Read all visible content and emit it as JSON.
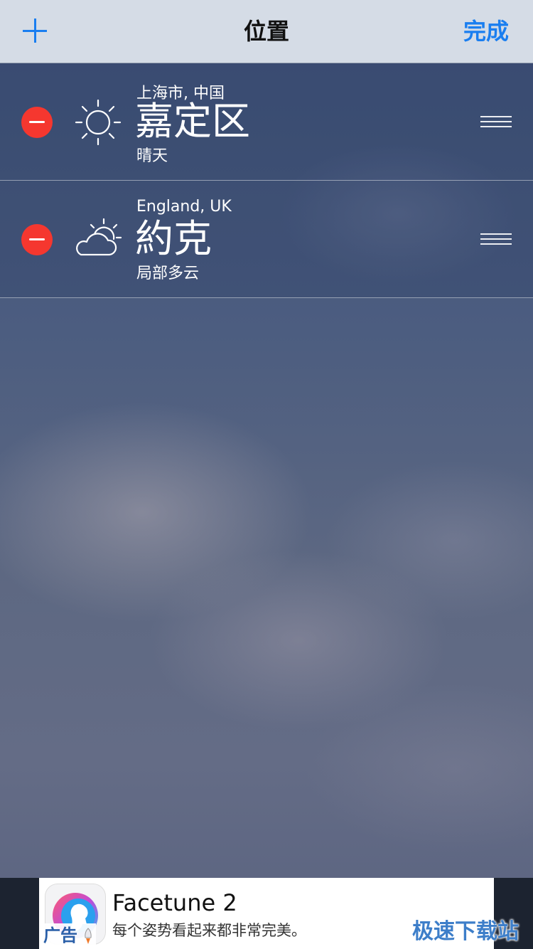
{
  "nav": {
    "title": "位置",
    "done_label": "完成",
    "add_icon": "plus-icon"
  },
  "locations": [
    {
      "region": "上海市, 中国",
      "city": "嘉定区",
      "condition": "晴天",
      "icon": "sun-icon"
    },
    {
      "region": "England, UK",
      "city": "約克",
      "condition": "局部多云",
      "icon": "partly-cloudy-icon"
    }
  ],
  "ad": {
    "title": "Facetune 2",
    "subtitle": "每个姿势看起来都非常完美。",
    "tag": "广告",
    "app_icon": "facetune-app-icon"
  },
  "watermark": "极速下载站",
  "colors": {
    "accent": "#1a7ef0",
    "delete": "#f5372f",
    "navbar": "#d5dce6"
  }
}
